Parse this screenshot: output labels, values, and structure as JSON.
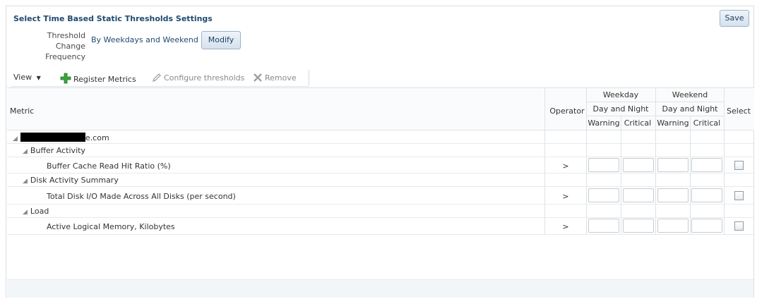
{
  "header": {
    "title": "Select Time Based Static Thresholds Settings",
    "save_label": "Save",
    "freq_label": "Threshold Change Frequency",
    "freq_value": "By Weekdays and Weekend",
    "modify_label": "Modify"
  },
  "toolbar": {
    "view_label": "View",
    "register_label": "Register Metrics",
    "configure_label": "Configure thresholds",
    "remove_label": "Remove"
  },
  "table": {
    "col_metric": "Metric",
    "col_operator": "Operator",
    "col_weekday": "Weekday",
    "col_weekend": "Weekend",
    "col_daynight": "Day and Night",
    "col_warning": "Warning",
    "col_critical": "Critical",
    "col_select": "Select",
    "target_suffix": "e.com",
    "groups": [
      {
        "name": "Buffer Activity",
        "metric": "Buffer Cache Read Hit Ratio (%)",
        "operator": ">"
      },
      {
        "name": "Disk Activity Summary",
        "metric": "Total Disk I/O Made Across All Disks (per second)",
        "operator": ">"
      },
      {
        "name": "Load",
        "metric": "Active Logical Memory, Kilobytes",
        "operator": ">"
      }
    ]
  }
}
